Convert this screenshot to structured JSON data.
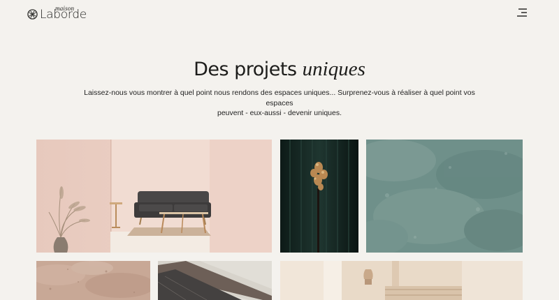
{
  "brand": {
    "small": "maison",
    "main": "Laborde"
  },
  "nav": {
    "menu_icon": "menu-icon"
  },
  "intro": {
    "title_plain": "Des projets",
    "title_italic": "uniques",
    "text_line1": "Laissez-nous vous montrer à quel point nous rendons des espaces uniques... Surprenez-vous à réaliser à quel point vos espaces",
    "text_line2": "peuvent - eux-aussi - devenir uniques."
  },
  "colors": {
    "background": "#f4f2ee",
    "text": "#1d1d1b"
  }
}
